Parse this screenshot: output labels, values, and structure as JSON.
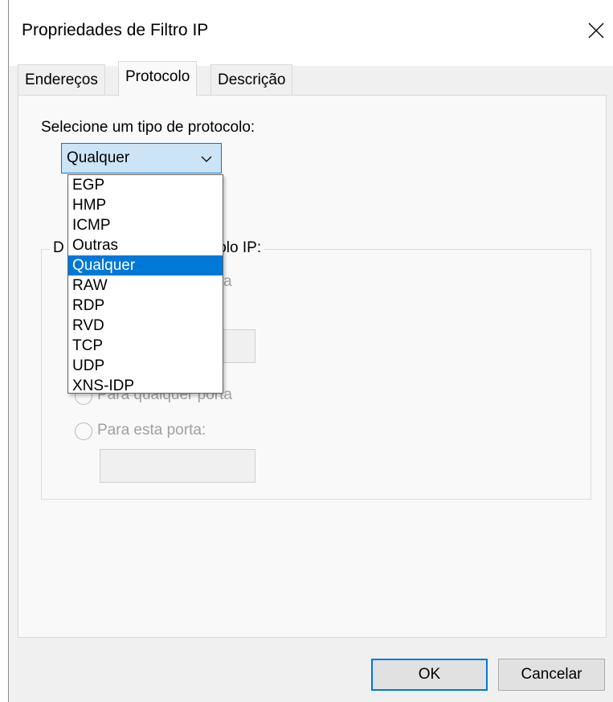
{
  "window": {
    "title": "Propriedades de Filtro IP"
  },
  "tabs": [
    {
      "label": "Endereços"
    },
    {
      "label": "Protocolo"
    },
    {
      "label": "Descrição"
    }
  ],
  "protocol": {
    "prompt": "Selecione um tipo de protocolo:",
    "selected": "Qualquer",
    "options": [
      "EGP",
      "HMP",
      "ICMP",
      "Outras",
      "Qualquer",
      "RAW",
      "RDP",
      "RVD",
      "TCP",
      "UDP",
      "XNS-IDP"
    ]
  },
  "group": {
    "legend_visible_start": "D",
    "legend_visible_end": "colo IP:",
    "partial_text": "a",
    "radio_any_port": "Para qualquer porta",
    "radio_this_port": "Para esta porta:"
  },
  "buttons": {
    "ok": "OK",
    "cancel": "Cancelar"
  },
  "colors": {
    "accent": "#0078d7",
    "combo_bg": "#cce4f7"
  }
}
